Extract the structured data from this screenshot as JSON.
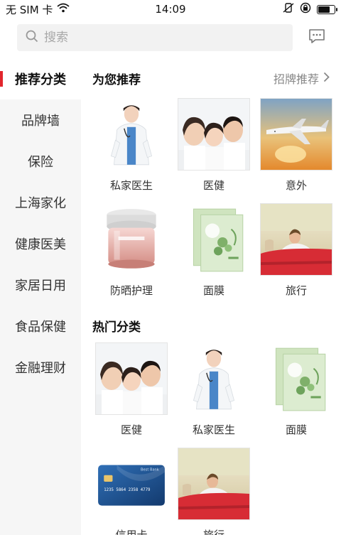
{
  "status_bar": {
    "carrier": "无 SIM 卡",
    "time": "14:09",
    "battery_level": 0.75
  },
  "search": {
    "placeholder": "搜索",
    "icon": "search-icon",
    "message_icon": "message-icon"
  },
  "sidebar": {
    "items": [
      {
        "label": "推荐分类",
        "active": true
      },
      {
        "label": "品牌墙",
        "active": false
      },
      {
        "label": "保险",
        "active": false
      },
      {
        "label": "上海家化",
        "active": false
      },
      {
        "label": "健康医美",
        "active": false
      },
      {
        "label": "家居日用",
        "active": false
      },
      {
        "label": "食品保健",
        "active": false
      },
      {
        "label": "金融理财",
        "active": false
      }
    ],
    "accent": "#e2262d"
  },
  "recommend": {
    "title": "为您推荐",
    "link_label": "招牌推荐",
    "items": [
      {
        "label": "私家医生",
        "image": "doctor"
      },
      {
        "label": "医健",
        "image": "family"
      },
      {
        "label": "意外",
        "image": "airplane"
      },
      {
        "label": "防晒护理",
        "image": "cream-jar"
      },
      {
        "label": "面膜",
        "image": "face-mask"
      },
      {
        "label": "旅行",
        "image": "convertible-car"
      }
    ]
  },
  "hot": {
    "title": "热门分类",
    "items": [
      {
        "label": "医健",
        "image": "family"
      },
      {
        "label": "私家医生",
        "image": "doctor"
      },
      {
        "label": "面膜",
        "image": "face-mask"
      },
      {
        "label": "信用卡",
        "image": "credit-card"
      },
      {
        "label": "旅行",
        "image": "convertible-car"
      }
    ]
  },
  "credit_card": {
    "brand": "Best Bank",
    "number": "1235 5864 2358 4779"
  }
}
